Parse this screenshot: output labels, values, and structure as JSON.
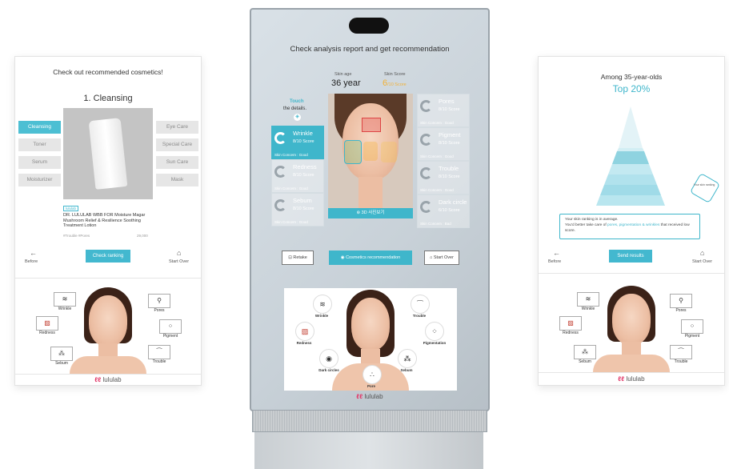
{
  "left_panel": {
    "title": "Check out recommended cosmetics!",
    "step": "1. Cleansing",
    "left_tabs": [
      "Cleansing",
      "Toner",
      "Serum",
      "Moisturizer"
    ],
    "right_tabs": [
      "Eye Care",
      "Special Care",
      "Sun Care",
      "Mask"
    ],
    "tag": "lululab",
    "product_name": "DR. LULULAB WBB FOR Moisture Magar Mushroom Relief & Resilience Soothing Treatment Lotion",
    "hashtags": "#Trouble #Pores",
    "price": "29,000",
    "before_label": "Before",
    "check_ranking_label": "Check ranking",
    "start_over_label": "Start Over",
    "concerns": [
      "Wrinkle",
      "Pores",
      "Redness",
      "Pigment",
      "Sebum",
      "Trouble"
    ],
    "logo": "lululab"
  },
  "kiosk": {
    "title": "Check analysis report and get recommendation",
    "skin_age_label": "Skin age",
    "skin_age_value": "36 year",
    "skin_score_label": "Skin Score",
    "skin_score_value": "6",
    "skin_score_unit": "/10 Score",
    "touch_label": "Touch",
    "touch_sub": "the details.",
    "cards_left": [
      {
        "name": "Wrinkle",
        "score": "8/10 Score",
        "foot": "Skin Concern : Good"
      },
      {
        "name": "Redness",
        "score": "8/10 Score",
        "foot": "Skin Concern : Good"
      },
      {
        "name": "Sebum",
        "score": "8/10 Score",
        "foot": "Skin Concern : Good"
      }
    ],
    "cards_right": [
      {
        "name": "Pores",
        "score": "8/10 Score",
        "foot": "Skin Concern : Good"
      },
      {
        "name": "Pigment",
        "score": "8/10 Score",
        "foot": "Skin Concern : Good"
      },
      {
        "name": "Trouble",
        "score": "8/10 Score",
        "foot": "Skin Concern : Good"
      },
      {
        "name": "Dark circle",
        "score": "6/10 Score",
        "foot": "Skin Concern : Bad"
      }
    ],
    "view_3d_label": "3D 사진보기",
    "retake_label": "Retake",
    "cosmetics_label": "Cosmetics recommendation",
    "start_over_label": "Start Over",
    "concerns": [
      "Wrinkle",
      "Trouble",
      "Pigmentation",
      "Redness",
      "Sebum",
      "Dark circles",
      "Pore"
    ],
    "logo": "lululab"
  },
  "right_panel": {
    "title": "Among 35-year-olds",
    "rank": "Top 20%",
    "pyramid_tag": "Your skin ranking",
    "msg_line1": "Your skin ranking is in average.",
    "msg_line2_pre": "You'd better take care of ",
    "msg_line2_hl": "pores, pigmentation & wrinkles",
    "msg_line2_post": " that received low score.",
    "before_label": "Before",
    "send_results_label": "Send results",
    "start_over_label": "Start Over",
    "concerns": [
      "Wrinkle",
      "Pores",
      "Redness",
      "Pigment",
      "Sebum",
      "Trouble"
    ],
    "logo": "lululab"
  },
  "colors": {
    "accent": "#43b8cf",
    "brand": "#e23a6a",
    "score": "#f2b135"
  },
  "icons": [
    "back-arrow-icon",
    "home-icon",
    "camera-icon",
    "3d-icon"
  ]
}
